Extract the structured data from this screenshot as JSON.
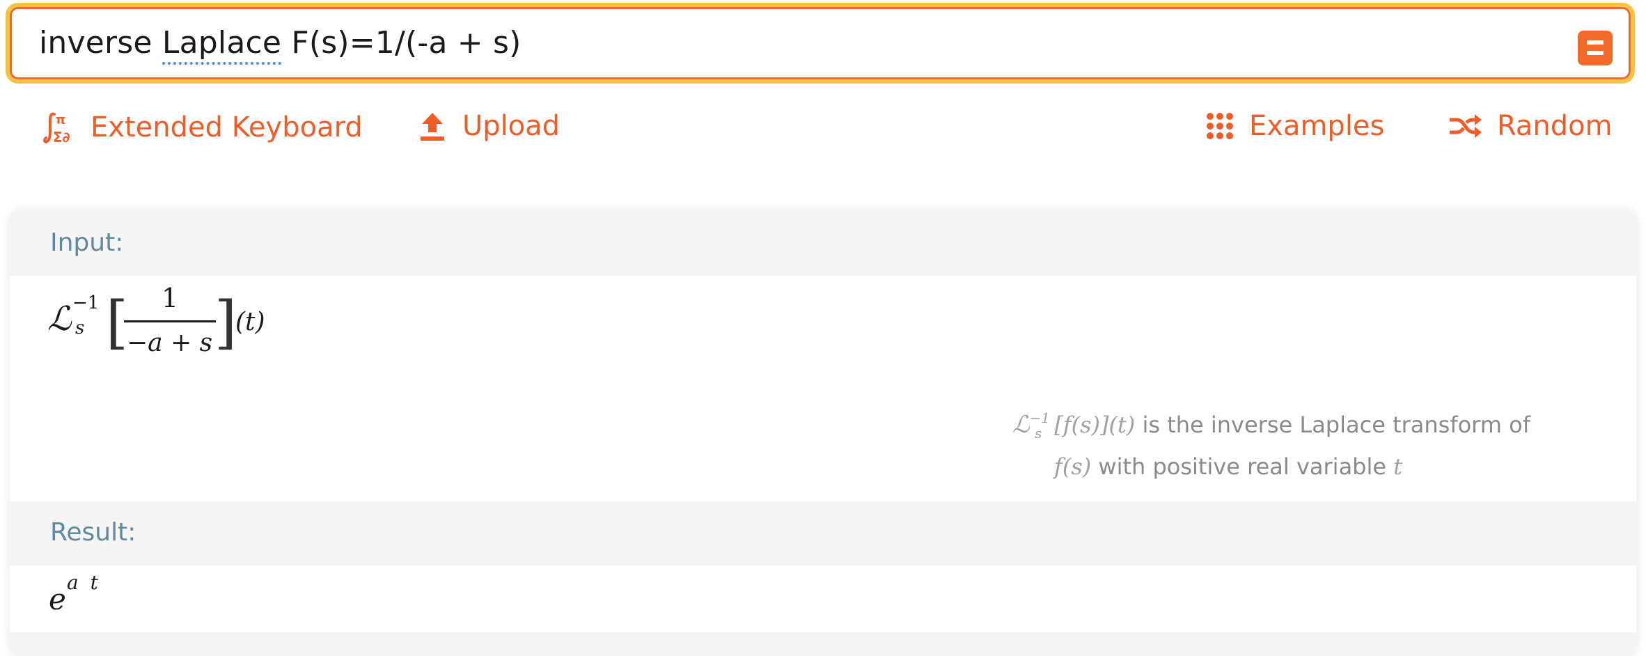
{
  "search": {
    "query_prefix": "inverse ",
    "query_underlined": "Laplace",
    "query_suffix": " F(s)=1/(-a + s)"
  },
  "toolbar": {
    "extended_keyboard": "Extended Keyboard",
    "upload": "Upload",
    "examples": "Examples",
    "random": "Random"
  },
  "pods": {
    "input": {
      "label": "Input:",
      "operator": "ℒ",
      "sub": "s",
      "sup": "−1",
      "numerator": "1",
      "denominator": "−a + s",
      "arg": "(t)",
      "note": {
        "expr_operator": "ℒ",
        "expr_sub": "s",
        "expr_sup": "−1",
        "expr_rest": "[f(s)](t)",
        "line1_text": " is the inverse Laplace transform of",
        "line2_fn": "f(s)",
        "line2_text": " with positive real variable ",
        "line2_var": "t"
      }
    },
    "result": {
      "label": "Result:",
      "base": "e",
      "exponent": "a t"
    }
  },
  "colors": {
    "accent": "#ee5d27",
    "search_border_outer": "#f6c343",
    "search_border_inner": "#ee6a33",
    "pod_label": "#5f8aa0",
    "note_text": "#8a8a8a",
    "spell_underline": "#4a8ee0"
  },
  "icons": {
    "extended_keyboard": "integral-pi-sigma-icon",
    "upload": "upload-arrow-icon",
    "examples": "grid-dots-icon",
    "random": "shuffle-icon",
    "submit": "equals-icon"
  }
}
